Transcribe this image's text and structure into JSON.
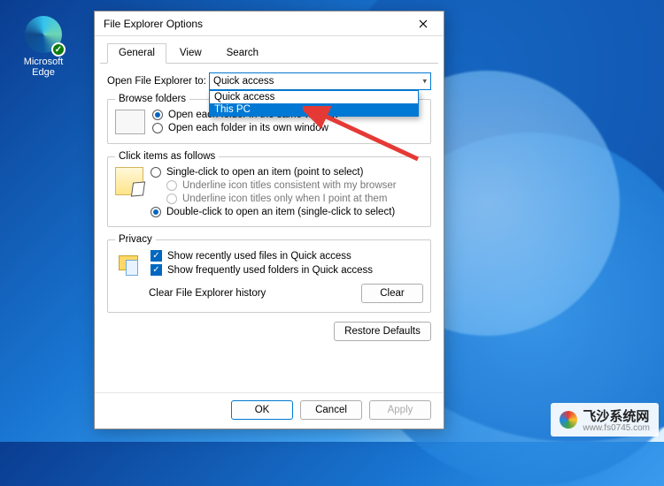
{
  "desktop": {
    "edge_label": "Microsoft Edge"
  },
  "dialog": {
    "title": "File Explorer Options",
    "tabs": {
      "general": "General",
      "view": "View",
      "search": "Search"
    },
    "open_label": "Open File Explorer to:",
    "combo_selected": "Quick access",
    "dropdown": {
      "opt0": "Quick access",
      "opt1": "This PC"
    },
    "groups": {
      "browse": {
        "legend": "Browse folders",
        "same": "Open each folder in the same window",
        "own": "Open each folder in its own window"
      },
      "click": {
        "legend": "Click items as follows",
        "single": "Single-click to open an item (point to select)",
        "ul_browser": "Underline icon titles consistent with my browser",
        "ul_point": "Underline icon titles only when I point at them",
        "double": "Double-click to open an item (single-click to select)"
      },
      "privacy": {
        "legend": "Privacy",
        "recent_files": "Show recently used files in Quick access",
        "freq_folders": "Show frequently used folders in Quick access",
        "clear_label": "Clear File Explorer history",
        "clear_btn": "Clear"
      }
    },
    "restore": "Restore Defaults",
    "buttons": {
      "ok": "OK",
      "cancel": "Cancel",
      "apply": "Apply"
    }
  },
  "watermark": {
    "name": "飞沙系统网",
    "url": "www.fs0745.com"
  }
}
